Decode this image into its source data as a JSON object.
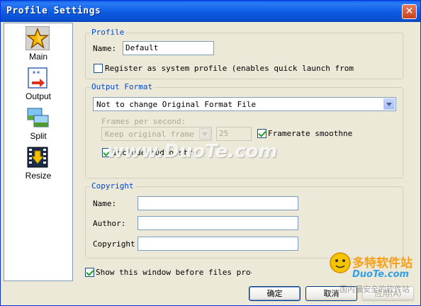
{
  "window": {
    "title": "Profile Settings",
    "close_glyph": "✕"
  },
  "sidebar": {
    "items": [
      {
        "label": "Main",
        "icon": "star-icon"
      },
      {
        "label": "Output",
        "icon": "output-icon"
      },
      {
        "label": "Split",
        "icon": "split-icon"
      },
      {
        "label": "Resize",
        "icon": "resize-icon"
      }
    ]
  },
  "profile": {
    "legend": "Profile",
    "name_label": "Name:",
    "name_value": "Default",
    "register_label": "Register as system profile (enables quick launch from Windo",
    "register_checked": false
  },
  "output_format": {
    "legend": "Output Format",
    "format_value": "Not to change Original Format File",
    "fps_label": "Frames per second:",
    "fps_select_value": "Keep original frame ra",
    "fps_number": "25",
    "framerate_smoothness_label": "Framerate smoothness",
    "framerate_smoothness_checked": true,
    "include_audio_label": "Include audio stre",
    "include_audio_checked": true
  },
  "copyright": {
    "legend": "Copyright",
    "name_label": "Name:",
    "author_label": "Author:",
    "copyright_label": "Copyright",
    "name_value": "",
    "author_value": "",
    "copyright_value": ""
  },
  "footer": {
    "show_window_label": "Show this window before files proc",
    "show_window_checked": true,
    "ok_label": "确定",
    "cancel_label": "取消",
    "apply_label": "应用(A)"
  },
  "watermarks": {
    "center": "www.DuoTe.com",
    "brand_cn": "多特软件站",
    "brand_en": "DuoTe.com",
    "bottom_cn": "国内最安全的软件站"
  }
}
